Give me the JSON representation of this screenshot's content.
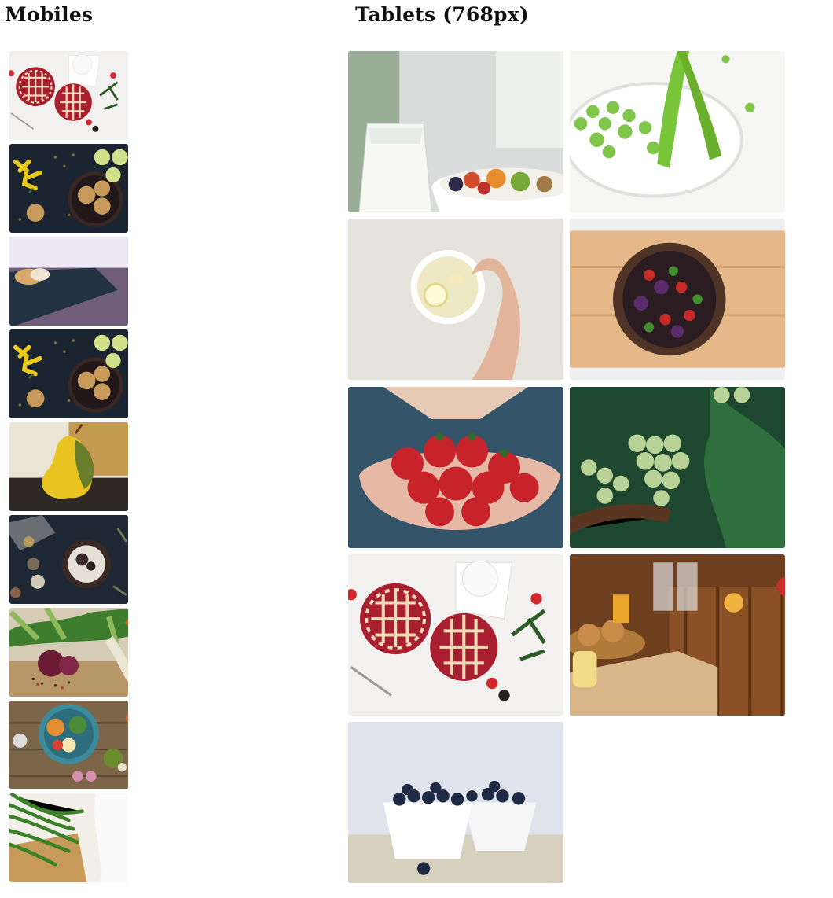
{
  "mobiles": {
    "title": "Mobiles",
    "photos": [
      "pies-icon",
      "cookies-icon",
      "dessert-icon",
      "cookies-icon",
      "pear-icon",
      "bowls-icon",
      "vegetables-icon",
      "salad-bowl-icon",
      "green-beans-icon"
    ]
  },
  "tablets": {
    "title": "Tablets (768px)",
    "photos": [
      "milk-fruit-bowl-icon",
      "peas-icon",
      "tea-cup-icon",
      "salad-board-icon",
      "strawberries-icon",
      "grapes-icon",
      "pies-icon",
      "buffet-icon",
      "blueberries-icon"
    ]
  }
}
